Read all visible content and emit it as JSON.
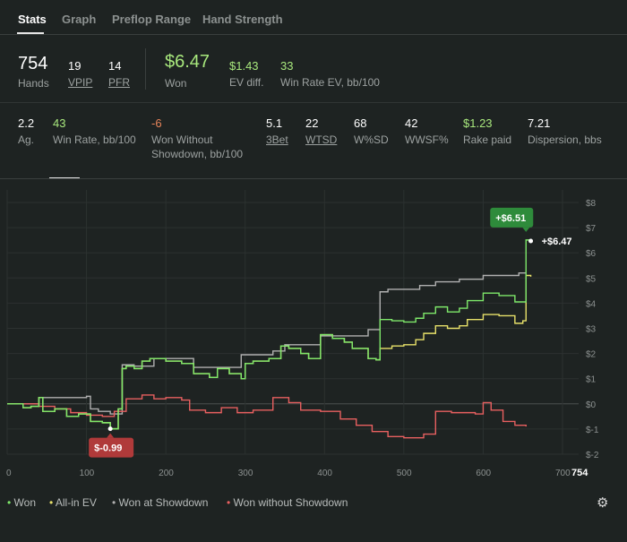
{
  "tabs": [
    "Stats",
    "Graph",
    "Preflop Range",
    "Hand Strength"
  ],
  "stats_row1": {
    "hands": {
      "value": "754",
      "label": "Hands"
    },
    "vpip": {
      "value": "19",
      "label": "VPIP"
    },
    "pfr": {
      "value": "14",
      "label": "PFR"
    },
    "won": {
      "value": "$6.47",
      "label": "Won"
    },
    "ev_diff": {
      "value": "$1.43",
      "label": "EV diff."
    },
    "winrate_ev": {
      "value": "33",
      "label": "Win Rate EV, bb/100"
    }
  },
  "stats_row2": {
    "ag": {
      "value": "2.2",
      "label": "Ag."
    },
    "winrate": {
      "value": "43",
      "label": "Win Rate, bb/100"
    },
    "won_wo_sd": {
      "value": "-6",
      "label1": "Won Without",
      "label2": "Showdown, bb/100"
    },
    "threebet": {
      "value": "5.1",
      "label": "3Bet"
    },
    "wtsd": {
      "value": "22",
      "label": "WTSD"
    },
    "wsd": {
      "value": "68",
      "label": "W%SD"
    },
    "wwsf": {
      "value": "42",
      "label": "WWSF%"
    },
    "rake": {
      "value": "$1.23",
      "label": "Rake paid"
    },
    "dispersion": {
      "value": "7.21",
      "label": "Dispersion, bbs"
    }
  },
  "chart_data": {
    "type": "line",
    "x_ticks": [
      "0",
      "100",
      "200",
      "300",
      "400",
      "500",
      "600",
      "700"
    ],
    "x_end_label": "754",
    "y_ticks": [
      "$8",
      "$7",
      "$6",
      "$5",
      "$4",
      "$3",
      "$2",
      "$1",
      "$0",
      "$-1",
      "$-2"
    ],
    "xlim": [
      0,
      754
    ],
    "ylim": [
      -2.0,
      8.0
    ],
    "annotations": {
      "max_badge": "+$6.51",
      "min_badge": "$-0.99",
      "end_label": "+$6.47"
    },
    "series": [
      {
        "name": "Won",
        "color": "#7ee86a",
        "points": [
          [
            0,
            0.0
          ],
          [
            20,
            -0.15
          ],
          [
            30,
            -0.1
          ],
          [
            40,
            0.25
          ],
          [
            45,
            -0.3
          ],
          [
            60,
            -0.2
          ],
          [
            75,
            -0.5
          ],
          [
            90,
            -0.4
          ],
          [
            105,
            -0.7
          ],
          [
            120,
            -0.75
          ],
          [
            130,
            -0.99
          ],
          [
            140,
            -0.2
          ],
          [
            145,
            1.4
          ],
          [
            150,
            1.5
          ],
          [
            160,
            1.4
          ],
          [
            170,
            1.7
          ],
          [
            180,
            1.8
          ],
          [
            200,
            1.7
          ],
          [
            220,
            1.6
          ],
          [
            235,
            1.2
          ],
          [
            255,
            1.05
          ],
          [
            265,
            1.4
          ],
          [
            280,
            1.2
          ],
          [
            295,
            1.0
          ],
          [
            300,
            1.6
          ],
          [
            310,
            1.7
          ],
          [
            330,
            1.8
          ],
          [
            345,
            2.3
          ],
          [
            355,
            2.2
          ],
          [
            370,
            2.0
          ],
          [
            380,
            1.8
          ],
          [
            395,
            2.75
          ],
          [
            410,
            2.6
          ],
          [
            425,
            2.45
          ],
          [
            435,
            2.2
          ],
          [
            455,
            1.8
          ],
          [
            465,
            1.75
          ],
          [
            470,
            3.35
          ],
          [
            485,
            3.3
          ],
          [
            500,
            3.25
          ],
          [
            515,
            3.4
          ],
          [
            525,
            3.6
          ],
          [
            540,
            3.85
          ],
          [
            555,
            3.65
          ],
          [
            570,
            3.8
          ],
          [
            580,
            4.1
          ],
          [
            600,
            4.4
          ],
          [
            620,
            4.3
          ],
          [
            640,
            4.05
          ],
          [
            650,
            4.05
          ],
          [
            654,
            6.51
          ],
          [
            660,
            6.47
          ]
        ]
      },
      {
        "name": "All-in EV",
        "color": "#e8e16a",
        "points": [
          [
            0,
            0.0
          ],
          [
            20,
            -0.15
          ],
          [
            30,
            -0.1
          ],
          [
            40,
            0.25
          ],
          [
            45,
            -0.3
          ],
          [
            60,
            -0.2
          ],
          [
            75,
            -0.5
          ],
          [
            90,
            -0.4
          ],
          [
            105,
            -0.7
          ],
          [
            120,
            -0.75
          ],
          [
            130,
            -0.99
          ],
          [
            140,
            -0.2
          ],
          [
            145,
            1.4
          ],
          [
            150,
            1.5
          ],
          [
            160,
            1.4
          ],
          [
            170,
            1.7
          ],
          [
            180,
            1.8
          ],
          [
            200,
            1.7
          ],
          [
            220,
            1.6
          ],
          [
            235,
            1.2
          ],
          [
            255,
            1.05
          ],
          [
            265,
            1.4
          ],
          [
            280,
            1.2
          ],
          [
            295,
            1.0
          ],
          [
            300,
            1.6
          ],
          [
            310,
            1.7
          ],
          [
            330,
            1.8
          ],
          [
            345,
            2.3
          ],
          [
            355,
            2.2
          ],
          [
            370,
            2.0
          ],
          [
            380,
            1.8
          ],
          [
            395,
            2.75
          ],
          [
            410,
            2.6
          ],
          [
            425,
            2.45
          ],
          [
            435,
            2.2
          ],
          [
            455,
            1.8
          ],
          [
            465,
            1.75
          ],
          [
            470,
            2.2
          ],
          [
            485,
            2.3
          ],
          [
            500,
            2.35
          ],
          [
            515,
            2.55
          ],
          [
            525,
            2.8
          ],
          [
            540,
            3.1
          ],
          [
            555,
            3.0
          ],
          [
            570,
            3.1
          ],
          [
            580,
            3.35
          ],
          [
            600,
            3.55
          ],
          [
            620,
            3.5
          ],
          [
            640,
            3.2
          ],
          [
            650,
            3.3
          ],
          [
            654,
            5.1
          ],
          [
            660,
            5.05
          ]
        ]
      },
      {
        "name": "Won at Showdown",
        "color": "#b0b0b0",
        "points": [
          [
            0,
            0.0
          ],
          [
            30,
            0.0
          ],
          [
            40,
            0.25
          ],
          [
            100,
            0.3
          ],
          [
            105,
            -0.2
          ],
          [
            115,
            -0.3
          ],
          [
            130,
            -0.4
          ],
          [
            145,
            1.55
          ],
          [
            155,
            1.55
          ],
          [
            160,
            1.5
          ],
          [
            175,
            1.5
          ],
          [
            185,
            1.8
          ],
          [
            225,
            1.8
          ],
          [
            235,
            1.45
          ],
          [
            290,
            1.45
          ],
          [
            295,
            1.95
          ],
          [
            335,
            2.1
          ],
          [
            350,
            2.35
          ],
          [
            365,
            2.35
          ],
          [
            395,
            2.7
          ],
          [
            455,
            2.95
          ],
          [
            470,
            4.45
          ],
          [
            480,
            4.55
          ],
          [
            520,
            4.7
          ],
          [
            540,
            4.85
          ],
          [
            570,
            4.95
          ],
          [
            600,
            5.1
          ],
          [
            645,
            5.2
          ],
          [
            654,
            5.2
          ]
        ]
      },
      {
        "name": "Won without Showdown",
        "color": "#e86060",
        "points": [
          [
            0,
            0.0
          ],
          [
            40,
            -0.1
          ],
          [
            60,
            -0.2
          ],
          [
            80,
            -0.35
          ],
          [
            100,
            -0.45
          ],
          [
            120,
            -0.5
          ],
          [
            135,
            -0.3
          ],
          [
            150,
            0.2
          ],
          [
            170,
            0.35
          ],
          [
            185,
            0.2
          ],
          [
            200,
            0.25
          ],
          [
            220,
            0.15
          ],
          [
            230,
            -0.25
          ],
          [
            250,
            -0.35
          ],
          [
            270,
            -0.15
          ],
          [
            290,
            -0.35
          ],
          [
            310,
            -0.25
          ],
          [
            335,
            0.25
          ],
          [
            355,
            0.05
          ],
          [
            370,
            -0.25
          ],
          [
            395,
            -0.3
          ],
          [
            420,
            -0.6
          ],
          [
            440,
            -0.85
          ],
          [
            460,
            -1.1
          ],
          [
            480,
            -1.3
          ],
          [
            500,
            -1.35
          ],
          [
            525,
            -1.2
          ],
          [
            540,
            -0.3
          ],
          [
            560,
            -0.35
          ],
          [
            590,
            -0.4
          ],
          [
            600,
            0.05
          ],
          [
            610,
            -0.25
          ],
          [
            625,
            -0.7
          ],
          [
            640,
            -0.85
          ],
          [
            654,
            -0.9
          ]
        ]
      }
    ]
  },
  "legend": [
    {
      "label": "Won",
      "color": "#7ee86a"
    },
    {
      "label": "All-in EV",
      "color": "#e8e16a"
    },
    {
      "label": "Won at Showdown",
      "color": "#b0b0b0"
    },
    {
      "label": "Won without Showdown",
      "color": "#e86060"
    }
  ]
}
